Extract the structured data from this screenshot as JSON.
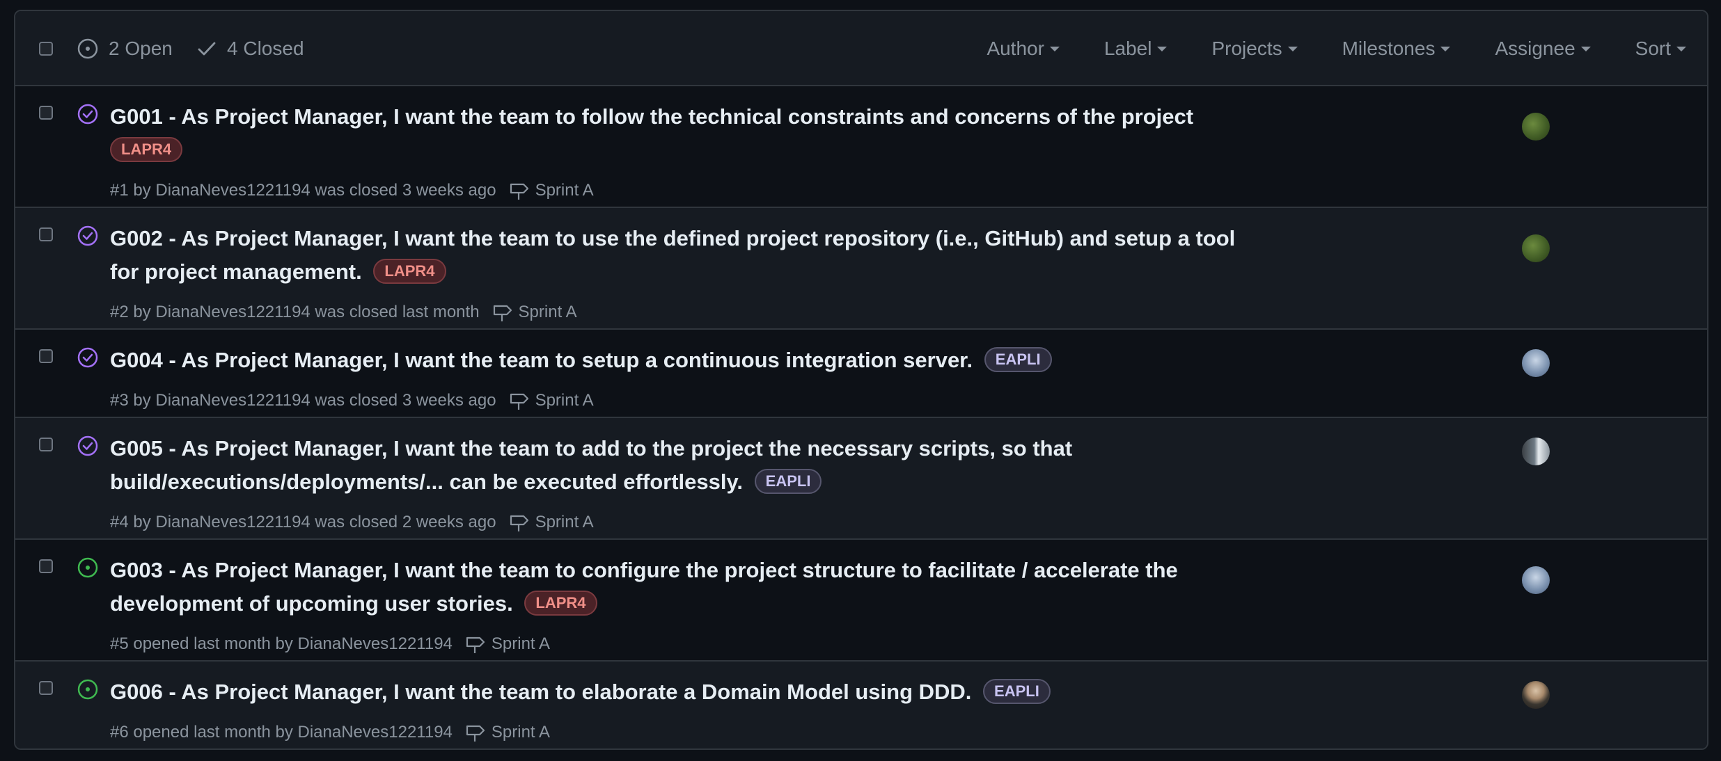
{
  "header": {
    "open_count": "2 Open",
    "closed_count": "4 Closed",
    "filters": [
      "Author",
      "Label",
      "Projects",
      "Milestones",
      "Assignee",
      "Sort"
    ]
  },
  "colors": {
    "closed_icon": "#a371f7",
    "open_icon": "#3fb950",
    "lapr4_bg": "#4b2227",
    "eapli_bg": "#2c2c3d"
  },
  "issues": [
    {
      "state": "closed",
      "title": "G001 - As Project Manager, I want the team to follow the technical constraints and concerns of the project",
      "label": "LAPR4",
      "meta": "#1 by DianaNeves1221194 was closed 3 weeks ago",
      "milestone": "Sprint A",
      "avatar": "green-avatar"
    },
    {
      "state": "closed",
      "title": "G002 - As Project Manager, I want the team to use the defined project repository (i.e., GitHub) and setup a tool for project management.",
      "label": "LAPR4",
      "meta": "#2 by DianaNeves1221194 was closed last month",
      "milestone": "Sprint A",
      "avatar": "green-avatar"
    },
    {
      "state": "closed",
      "title": "G004 - As Project Manager, I want the team to setup a continuous integration server.",
      "label": "EAPLI",
      "meta": "#3 by DianaNeves1221194 was closed 3 weeks ago",
      "milestone": "Sprint A",
      "avatar": "blue-avatar"
    },
    {
      "state": "closed",
      "title": "G005 - As Project Manager, I want the team to add to the project the necessary scripts, so that build/executions/deployments/... can be executed effortlessly.",
      "label": "EAPLI",
      "meta": "#4 by DianaNeves1221194 was closed 2 weeks ago",
      "milestone": "Sprint A",
      "avatar": "gray-avatar"
    },
    {
      "state": "open",
      "title": "G003 - As Project Manager, I want the team to configure the project structure to facilitate / accelerate the development of upcoming user stories.",
      "label": "LAPR4",
      "meta": "#5 opened last month by DianaNeves1221194",
      "milestone": "Sprint A",
      "avatar": "blue-avatar"
    },
    {
      "state": "open",
      "title": "G006 - As Project Manager, I want the team to elaborate a Domain Model using DDD.",
      "label": "EAPLI",
      "meta": "#6 opened last month by DianaNeves1221194",
      "milestone": "Sprint A",
      "avatar": "person-avatar"
    }
  ]
}
